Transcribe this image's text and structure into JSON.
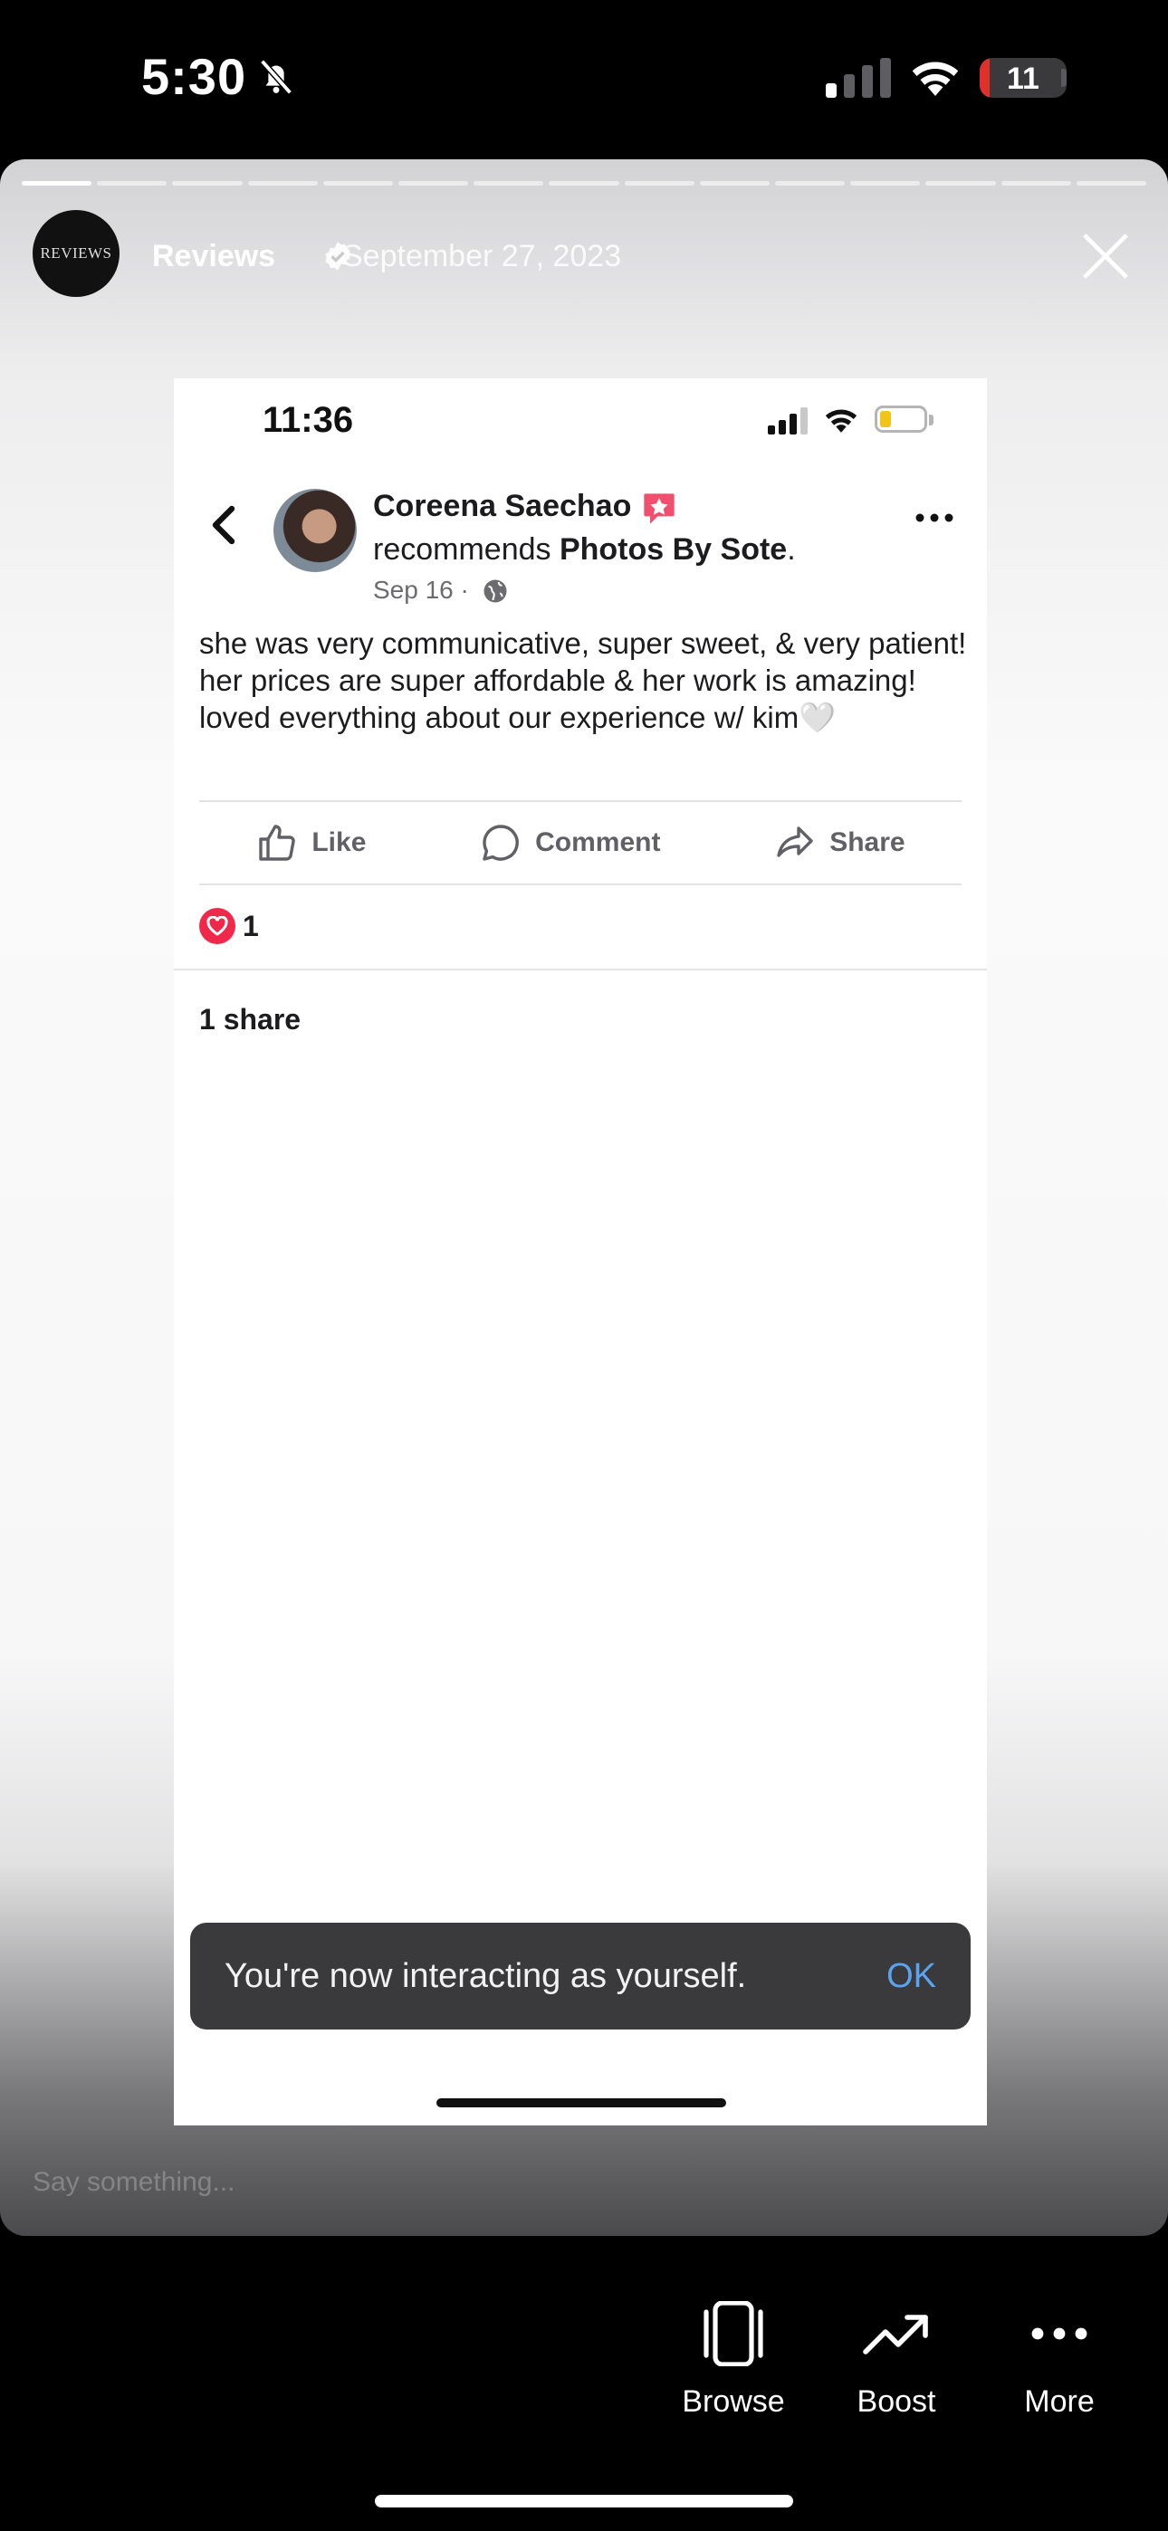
{
  "status_bar": {
    "time": "5:30",
    "battery": "11",
    "battery_level": 0.11
  },
  "story": {
    "account_logo": "REVIEWS",
    "account_name": "Reviews",
    "date": "September 27, 2023",
    "progress": {
      "segments": 15,
      "completed": 1
    },
    "reply_placeholder": "Say something..."
  },
  "inner_screenshot": {
    "time": "11:36",
    "author": "Coreena Saechao",
    "recommends_prefix": "recommends ",
    "page_name": "Photos By Sote",
    "recommends_suffix": ".",
    "post_date": "Sep 16 ·",
    "post_text": "she was very communicative, super sweet, & very patient! her prices are super affordable & her work is amazing! loved everything about our experience w/ kim🤍",
    "actions": {
      "like": "Like",
      "comment": "Comment",
      "share": "Share"
    },
    "reactions_count": "1",
    "shares_text": "1 share"
  },
  "toast": {
    "message": "You're now interacting as yourself.",
    "ok_label": "OK"
  },
  "toolbar": {
    "browse": "Browse",
    "boost": "Boost",
    "more": "More"
  },
  "colors": {
    "toast_ok": "#5aa3f0",
    "heart": "#f0284a",
    "battery_low": "#e0302a"
  }
}
